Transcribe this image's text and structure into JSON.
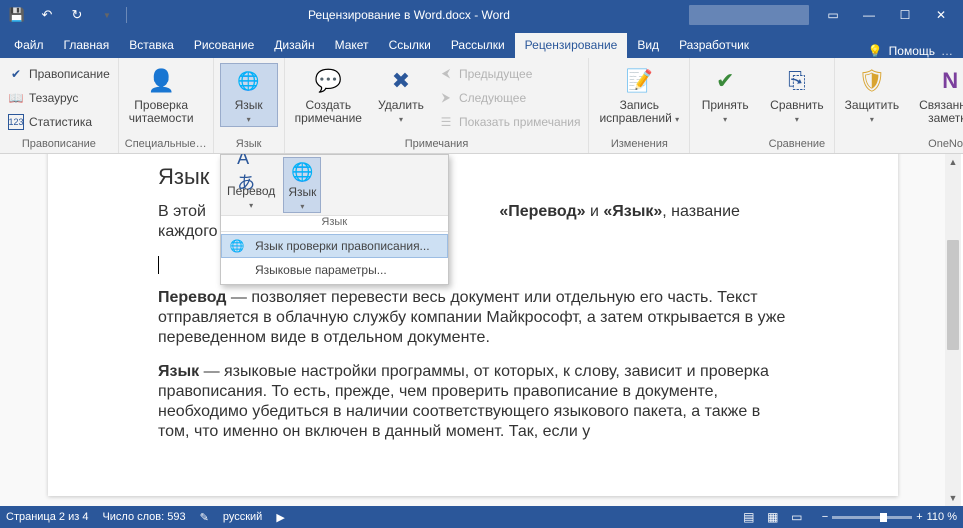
{
  "app_title": "Рецензирование в Word.docx  -  Word",
  "tabs": {
    "file": "Файл",
    "items": [
      "Главная",
      "Вставка",
      "Рисование",
      "Дизайн",
      "Макет",
      "Ссылки",
      "Рассылки",
      "Рецензирование",
      "Вид",
      "Разработчик"
    ],
    "help": "Помощь"
  },
  "ribbon": {
    "proofing": {
      "label": "Правописание",
      "spelling": "Правописание",
      "thesaurus": "Тезаурус",
      "statistics": "Статистика"
    },
    "accessibility": {
      "label": "Специальные…",
      "check": "Проверка\nчитаемости"
    },
    "language": {
      "label": "Язык",
      "btn": "Язык"
    },
    "comments": {
      "label": "Примечания",
      "new": "Создать\nпримечание",
      "delete": "Удалить",
      "prev": "Предыдущее",
      "next": "Следующее",
      "show": "Показать примечания"
    },
    "tracking": {
      "label": "Изменения",
      "track": "Запись\nисправлений"
    },
    "changes": {
      "accept": "Принять"
    },
    "compare": {
      "label": "Сравнение",
      "compare": "Сравнить"
    },
    "protect": {
      "protect": "Защитить"
    },
    "onenote": {
      "label": "OneNote",
      "linked": "Связанные\nзаметки"
    }
  },
  "dropdown": {
    "translate": "Перевод",
    "language": "Язык",
    "group_label": "Язык",
    "item_proofing": "Язык проверки правописания...",
    "item_prefs": "Языковые параметры..."
  },
  "document": {
    "heading": "Язык",
    "p1_a": "В этой",
    "p1_b": "«Перевод»",
    "p1_c": " и ",
    "p1_d": "«Язык»",
    "p1_e": ", название каждого из н",
    "p2_b": "Перевод",
    "p2": " — позволяет перевести весь документ или отдельную его часть. Текст отправляется в облачную службу компании Майкрософт, а затем открывается в уже переведенном виде в отдельном документе.",
    "p3_b": "Язык",
    "p3": " — языковые настройки программы, от которых, к слову, зависит и проверка правописания. То есть, прежде, чем проверить правописание в документе, необходимо убедиться в наличии соответствующего языкового пакета, а также в том, что именно он включен в данный момент. Так, если у"
  },
  "status": {
    "page": "Страница 2 из 4",
    "words": "Число слов: 593",
    "lang": "русский",
    "zoom": "110 %"
  }
}
